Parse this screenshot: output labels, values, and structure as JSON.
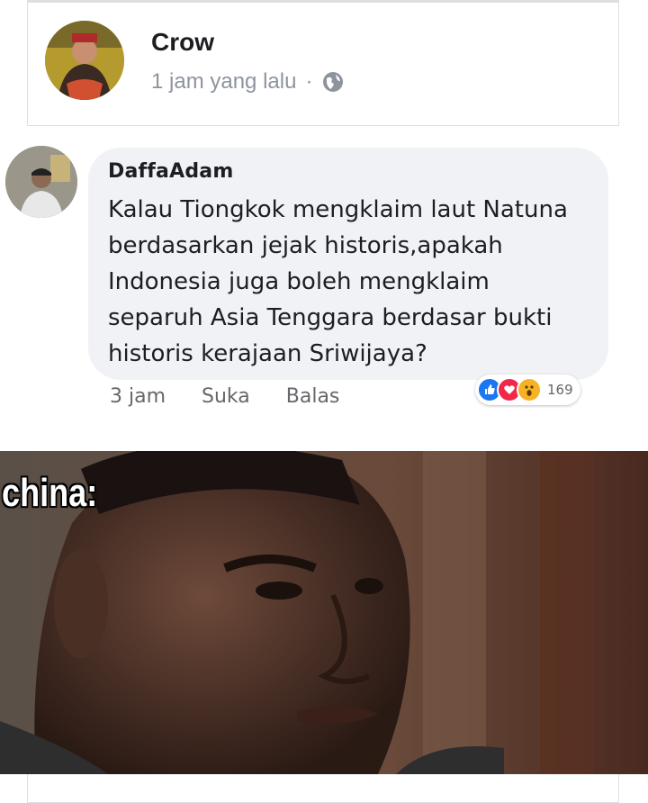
{
  "post": {
    "author": "Crow",
    "time": "1 jam yang lalu",
    "separator": "·",
    "privacy_icon": "globe-icon"
  },
  "comment": {
    "author": "DaffaAdam",
    "text_lines": [
      "Kalau Tiongkok mengklaim laut Natuna",
      "berdasarkan jejak historis,apakah",
      "Indonesia juga boleh mengklaim",
      "separuh Asia Tenggara berdasar bukti",
      "historis kerajaan Sriwijaya?"
    ],
    "time": "3 jam",
    "like_label": "Suka",
    "reply_label": "Balas",
    "reactions": {
      "icons": [
        "like-icon",
        "love-icon",
        "wow-icon"
      ],
      "count": "169"
    }
  },
  "meme": {
    "caption": "china:"
  },
  "colors": {
    "bubble": "#f0f2f5",
    "like": "#1877f2",
    "love": "#f02849",
    "wow": "#f7b125",
    "meta_text": "#8d949e"
  }
}
